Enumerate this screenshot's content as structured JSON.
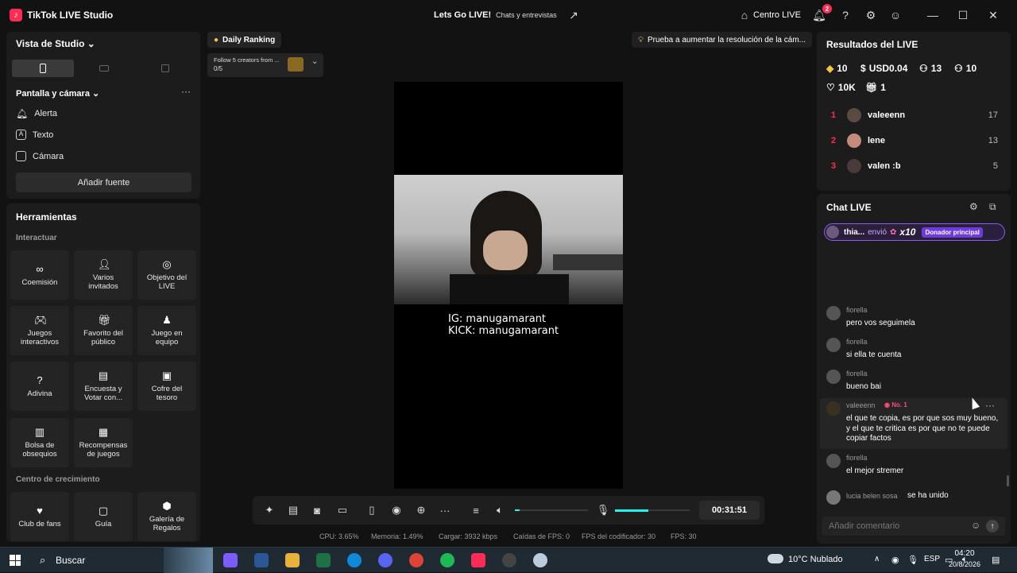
{
  "app": {
    "name": "TikTok LIVE Studio"
  },
  "titlebar": {
    "stream_title": "Lets Go LIVE!",
    "stream_category": "Chats y entrevistas",
    "centro_label": "Centro LIVE",
    "notif_count": "2",
    "icons": [
      "share-icon",
      "home-icon",
      "bell-icon",
      "help-icon",
      "gear-icon",
      "profile-icon",
      "minimize-icon",
      "maximize-icon",
      "close-icon"
    ]
  },
  "left": {
    "studio_view": "Vista de Studio",
    "screen_camera": "Pantalla y cámara",
    "sources": [
      {
        "label": "Alerta",
        "icon": "bell-icon"
      },
      {
        "label": "Texto",
        "icon": "text-icon"
      },
      {
        "label": "Cámara",
        "icon": "camera-icon"
      }
    ],
    "add_source": "Añadir fuente",
    "tools_title": "Herramientas",
    "section_interact": "Interactuar",
    "section_growth": "Centro de crecimiento",
    "tools": [
      {
        "label": "Coemisión",
        "icon": "link-icon"
      },
      {
        "label": "Varios invitados",
        "icon": "users-icon"
      },
      {
        "label": "Objetivo del LIVE",
        "icon": "target-icon"
      },
      {
        "label": "Juegos interactivos",
        "icon": "gamepad-icon"
      },
      {
        "label": "Favorito del público",
        "icon": "gift-icon"
      },
      {
        "label": "Juego en equipo",
        "icon": "team-icon"
      },
      {
        "label": "Adivina",
        "icon": "question-icon"
      },
      {
        "label": "Encuesta y Votar con...",
        "icon": "poll-icon"
      },
      {
        "label": "Cofre del tesoro",
        "icon": "chest-icon"
      },
      {
        "label": "Bolsa de obsequios",
        "icon": "bag-icon"
      },
      {
        "label": "Recompensas de juegos",
        "icon": "reward-icon"
      }
    ],
    "growth": [
      {
        "label": "Club de fans",
        "icon": "heart-icon"
      },
      {
        "label": "Guía",
        "icon": "guide-icon"
      },
      {
        "label": "Galería de Regalos",
        "icon": "gallery-icon"
      }
    ]
  },
  "center": {
    "daily_ranking": "Daily Ranking",
    "follow_text": "Follow 5 creators from ...",
    "follow_progress": "0/5",
    "tip": "Prueba a aumentar la resolución de la cám...",
    "overlay_ig": "IG: manugamarant",
    "overlay_kick": "KICK: manugamarant",
    "timer": "00:31:51",
    "volume_level": 0.06,
    "mic_level": 0.45,
    "stats": {
      "cpu": "CPU: 3.65%",
      "mem": "Memoria: 1.49%",
      "upload": "Cargar: 3932 kbps",
      "fps_drop": "Caídas de FPS: 0",
      "encoder_fps": "FPS del codificador: 30",
      "fps": "FPS: 30"
    }
  },
  "results": {
    "title": "Resultados del LIVE",
    "diamonds": "10",
    "usd": "USD0.04",
    "viewers": "13",
    "new_followers": "10",
    "likes": "10K",
    "gifters": "1",
    "ranking": [
      {
        "rank": "1",
        "name": "valeeenn",
        "score": "17"
      },
      {
        "rank": "2",
        "name": "lene",
        "score": "13"
      },
      {
        "rank": "3",
        "name": "valen :b",
        "score": "5"
      }
    ]
  },
  "chat": {
    "title": "Chat LIVE",
    "gift": {
      "user": "thia...",
      "verb": "envió",
      "count": "x10",
      "tag": "Donador principal"
    },
    "messages": [
      {
        "user": "fiorella",
        "text": "pero vos seguimela"
      },
      {
        "user": "fiorella",
        "text": "si ella te cuenta"
      },
      {
        "user": "fiorella",
        "text": "bueno bai"
      },
      {
        "user": "valeeenn",
        "badge": "No. 1",
        "text": "el que te copia, es por que sos muy bueno, y el que te critica es por que no te puede copiar factos"
      },
      {
        "user": "fiorella",
        "text": "el mejor stremer"
      }
    ],
    "join": {
      "user": "lucia belen sosa",
      "text": "se ha unido"
    },
    "comment_placeholder": "Añadir comentario"
  },
  "taskbar": {
    "search": "Buscar",
    "weather": "10°C  Nublado",
    "lang": "ESP",
    "time": "04:20",
    "date": "20/8/2026"
  }
}
